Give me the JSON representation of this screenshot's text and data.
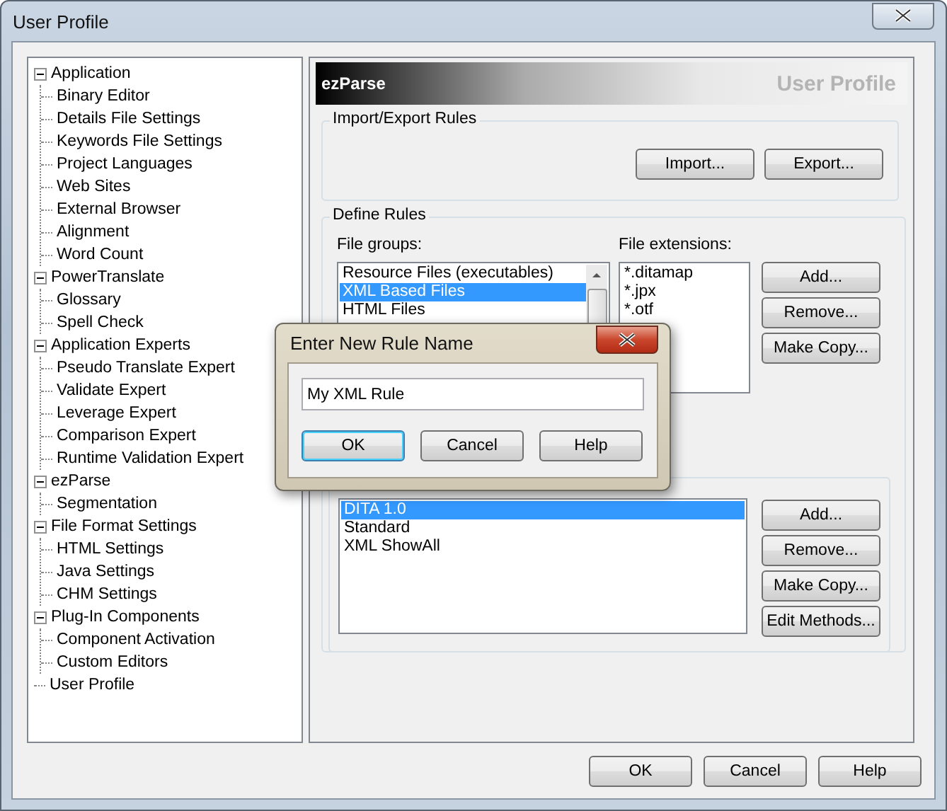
{
  "window": {
    "title": "User Profile"
  },
  "tree": [
    {
      "label": "Application",
      "expanded": true,
      "children": [
        {
          "label": "Binary Editor"
        },
        {
          "label": "Details File Settings"
        },
        {
          "label": "Keywords File Settings"
        },
        {
          "label": "Project Languages"
        },
        {
          "label": "Web Sites"
        },
        {
          "label": "External Browser"
        },
        {
          "label": "Alignment"
        },
        {
          "label": "Word Count"
        }
      ]
    },
    {
      "label": "PowerTranslate",
      "expanded": true,
      "children": [
        {
          "label": "Glossary"
        },
        {
          "label": "Spell Check"
        }
      ]
    },
    {
      "label": "Application Experts",
      "expanded": true,
      "children": [
        {
          "label": "Pseudo Translate Expert"
        },
        {
          "label": "Validate Expert"
        },
        {
          "label": "Leverage Expert"
        },
        {
          "label": "Comparison Expert"
        },
        {
          "label": "Runtime Validation Expert"
        }
      ]
    },
    {
      "label": "ezParse",
      "expanded": true,
      "children": [
        {
          "label": "Segmentation"
        }
      ]
    },
    {
      "label": "File Format Settings",
      "expanded": true,
      "children": [
        {
          "label": "HTML Settings"
        },
        {
          "label": "Java Settings"
        },
        {
          "label": "CHM Settings"
        }
      ]
    },
    {
      "label": "Plug-In Components",
      "expanded": true,
      "children": [
        {
          "label": "Component Activation"
        },
        {
          "label": "Custom Editors"
        }
      ]
    },
    {
      "label": "User Profile"
    }
  ],
  "panel": {
    "title": "ezParse",
    "subtitle": "User Profile"
  },
  "import_export": {
    "label": "Import/Export Rules",
    "buttons": [
      "Import...",
      "Export..."
    ]
  },
  "define_rules": {
    "label": "Define Rules",
    "file_groups_label": "File groups:",
    "file_groups": [
      {
        "label": "Resource Files (executables)",
        "selected": false
      },
      {
        "label": "XML Based Files",
        "selected": true
      },
      {
        "label": "HTML Files",
        "selected": false
      }
    ],
    "file_extensions_label": "File extensions:",
    "file_extensions": [
      "*.ditamap",
      "*.jpx",
      "*.otf"
    ],
    "extension_buttons": [
      "Add...",
      "Remove...",
      "Make Copy..."
    ],
    "rules": [
      {
        "label": "DITA 1.0",
        "selected": true
      },
      {
        "label": "Standard",
        "selected": false
      },
      {
        "label": "XML ShowAll",
        "selected": false
      }
    ],
    "rule_buttons": [
      "Add...",
      "Remove...",
      "Make Copy...",
      "Edit Methods..."
    ]
  },
  "dialog": {
    "title": "Enter New Rule Name",
    "value": "My XML Rule",
    "buttons": [
      {
        "label": "OK",
        "default": true
      },
      {
        "label": "Cancel",
        "default": false
      },
      {
        "label": "Help",
        "default": false
      }
    ]
  },
  "buttons": [
    "OK",
    "Cancel",
    "Help"
  ]
}
